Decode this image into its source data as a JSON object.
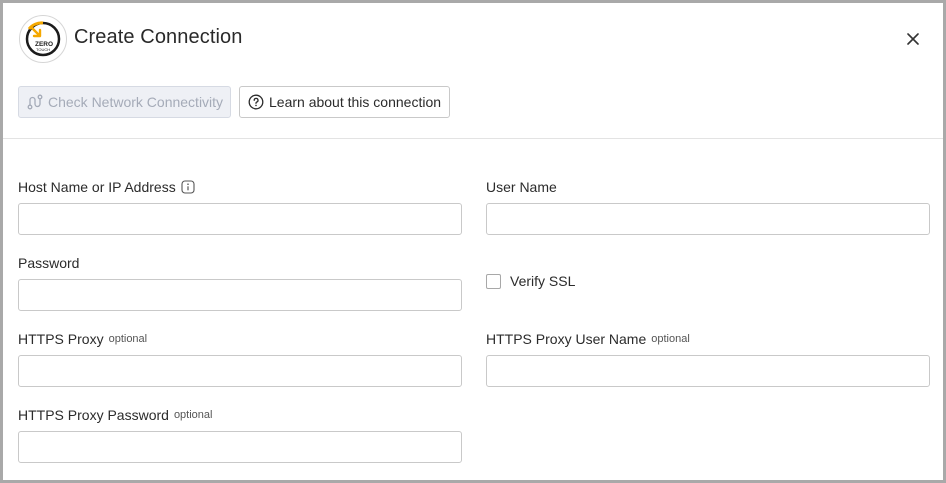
{
  "dialog": {
    "title": "Create Connection",
    "logo": {
      "text_top": "ZERO",
      "text_bottom": "TOUCH",
      "accent": "#f5a800"
    }
  },
  "toolbar": {
    "check_connectivity_label": "Check Network Connectivity",
    "check_connectivity_icon": "network-path-icon",
    "learn_label": "Learn about this connection",
    "learn_icon": "help-circle-icon"
  },
  "form": {
    "host": {
      "label": "Host Name or IP Address",
      "value": "",
      "info_icon": "info-icon"
    },
    "user_name": {
      "label": "User Name",
      "value": ""
    },
    "password": {
      "label": "Password",
      "value": ""
    },
    "verify_ssl": {
      "label": "Verify SSL",
      "checked": false
    },
    "https_proxy": {
      "label": "HTTPS Proxy",
      "optional": "optional",
      "value": ""
    },
    "https_proxy_user": {
      "label": "HTTPS Proxy User Name",
      "optional": "optional",
      "value": ""
    },
    "https_proxy_password": {
      "label": "HTTPS Proxy Password",
      "optional": "optional",
      "value": ""
    }
  },
  "colors": {
    "border": "#a9a9a9",
    "disabled_bg": "#eef0f5",
    "disabled_text": "#a5abb8",
    "accent": "#f5a800"
  }
}
